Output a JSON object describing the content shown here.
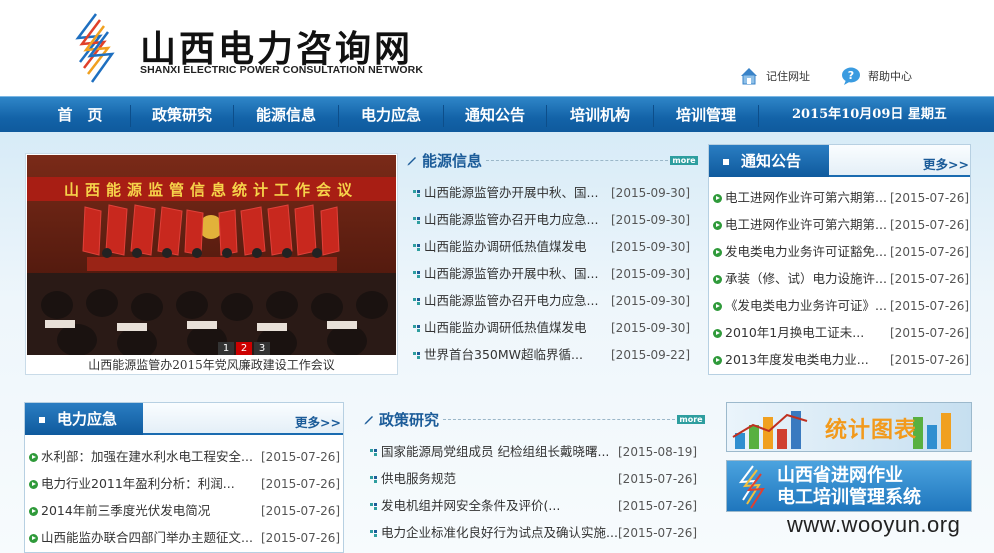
{
  "header": {
    "title": "山西电力咨询网",
    "subtitle": "SHANXI ELECTRIC POWER CONSULTATION NETWORK",
    "links": [
      {
        "label": "记住网址",
        "icon": "house-icon"
      },
      {
        "label": "帮助中心",
        "icon": "help-bubble-icon"
      }
    ]
  },
  "nav": {
    "items": [
      "首　页",
      "政策研究",
      "能源信息",
      "电力应急",
      "通知公告",
      "培训机构",
      "培训管理"
    ],
    "date": "2015年10月09日  星期五"
  },
  "slideshow": {
    "banner_text": "山西能源监管信息统计工作会议",
    "caption": "山西能源监管办2015年党风廉政建设工作会议",
    "pages": [
      "1",
      "2",
      "3"
    ],
    "active_page": 1
  },
  "energy_info": {
    "title": "能源信息",
    "more": "more",
    "items": [
      {
        "text": "山西能源监管办开展中秋、国...",
        "date": "[2015-09-30]"
      },
      {
        "text": "山西能源监管办召开电力应急...",
        "date": "[2015-09-30]"
      },
      {
        "text": "山西能监办调研低热值煤发电",
        "date": "[2015-09-30]"
      },
      {
        "text": "山西能源监管办开展中秋、国...",
        "date": "[2015-09-30]"
      },
      {
        "text": "山西能源监管办召开电力应急...",
        "date": "[2015-09-30]"
      },
      {
        "text": "山西能监办调研低热值煤发电",
        "date": "[2015-09-30]"
      },
      {
        "text": "世界首台350MW超临界循...",
        "date": "[2015-09-22]"
      }
    ]
  },
  "notices": {
    "title": "通知公告",
    "more": "更多>>",
    "items": [
      {
        "text": "电工进网作业许可第六期第...",
        "date": "[2015-07-26]"
      },
      {
        "text": "电工进网作业许可第六期第...",
        "date": "[2015-07-26]"
      },
      {
        "text": "发电类电力业务许可证豁免...",
        "date": "[2015-07-26]"
      },
      {
        "text": "承装（修、试）电力设施许...",
        "date": "[2015-07-26]"
      },
      {
        "text": "《发电类电力业务许可证》...",
        "date": "[2015-07-26]"
      },
      {
        "text": "2010年1月换电工证未...",
        "date": "[2015-07-26]"
      },
      {
        "text": "2013年度发电类电力业...",
        "date": "[2015-07-26]"
      }
    ]
  },
  "emergency": {
    "title": "电力应急",
    "more": "更多>>",
    "items": [
      {
        "text": "水利部：加强在建水利水电工程安全...",
        "date": "[2015-07-26]"
      },
      {
        "text": "电力行业2011年盈利分析：利润...",
        "date": "[2015-07-26]"
      },
      {
        "text": "2014年前三季度光伏发电简况",
        "date": "[2015-07-26]"
      },
      {
        "text": "山西能监办联合四部门举办主题征文...",
        "date": "[2015-07-26]"
      }
    ]
  },
  "policy": {
    "title": "政策研究",
    "more": "more",
    "items": [
      {
        "text": "国家能源局党组成员 纪检组组长戴晓曙...",
        "date": "[2015-08-19]"
      },
      {
        "text": "供电服务规范",
        "date": "[2015-07-26]"
      },
      {
        "text": "发电机组并网安全条件及评价(...",
        "date": "[2015-07-26]"
      },
      {
        "text": "电力企业标准化良好行为试点及确认实施...",
        "date": "[2015-07-26]"
      }
    ]
  },
  "banners": {
    "stats": "统计图表",
    "training_line1": "山西省进网作业",
    "training_line2": "电工培训管理系统"
  },
  "watermark": "www.wooyun.org",
  "colors": {
    "nav_blue": "#1363a8",
    "title_blue": "#1c5c99",
    "bullet_green": "#2f9a3a",
    "more_teal": "#2e9e9f"
  }
}
